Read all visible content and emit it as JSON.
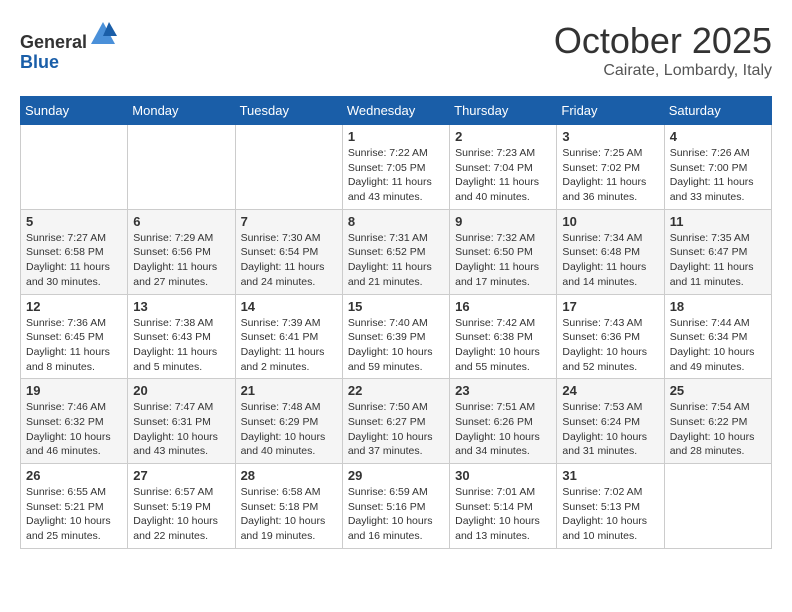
{
  "header": {
    "logo_general": "General",
    "logo_blue": "Blue",
    "month_title": "October 2025",
    "location": "Cairate, Lombardy, Italy"
  },
  "calendar": {
    "days_of_week": [
      "Sunday",
      "Monday",
      "Tuesday",
      "Wednesday",
      "Thursday",
      "Friday",
      "Saturday"
    ],
    "weeks": [
      [
        {
          "day": "",
          "info": ""
        },
        {
          "day": "",
          "info": ""
        },
        {
          "day": "",
          "info": ""
        },
        {
          "day": "1",
          "info": "Sunrise: 7:22 AM\nSunset: 7:05 PM\nDaylight: 11 hours\nand 43 minutes."
        },
        {
          "day": "2",
          "info": "Sunrise: 7:23 AM\nSunset: 7:04 PM\nDaylight: 11 hours\nand 40 minutes."
        },
        {
          "day": "3",
          "info": "Sunrise: 7:25 AM\nSunset: 7:02 PM\nDaylight: 11 hours\nand 36 minutes."
        },
        {
          "day": "4",
          "info": "Sunrise: 7:26 AM\nSunset: 7:00 PM\nDaylight: 11 hours\nand 33 minutes."
        }
      ],
      [
        {
          "day": "5",
          "info": "Sunrise: 7:27 AM\nSunset: 6:58 PM\nDaylight: 11 hours\nand 30 minutes."
        },
        {
          "day": "6",
          "info": "Sunrise: 7:29 AM\nSunset: 6:56 PM\nDaylight: 11 hours\nand 27 minutes."
        },
        {
          "day": "7",
          "info": "Sunrise: 7:30 AM\nSunset: 6:54 PM\nDaylight: 11 hours\nand 24 minutes."
        },
        {
          "day": "8",
          "info": "Sunrise: 7:31 AM\nSunset: 6:52 PM\nDaylight: 11 hours\nand 21 minutes."
        },
        {
          "day": "9",
          "info": "Sunrise: 7:32 AM\nSunset: 6:50 PM\nDaylight: 11 hours\nand 17 minutes."
        },
        {
          "day": "10",
          "info": "Sunrise: 7:34 AM\nSunset: 6:48 PM\nDaylight: 11 hours\nand 14 minutes."
        },
        {
          "day": "11",
          "info": "Sunrise: 7:35 AM\nSunset: 6:47 PM\nDaylight: 11 hours\nand 11 minutes."
        }
      ],
      [
        {
          "day": "12",
          "info": "Sunrise: 7:36 AM\nSunset: 6:45 PM\nDaylight: 11 hours\nand 8 minutes."
        },
        {
          "day": "13",
          "info": "Sunrise: 7:38 AM\nSunset: 6:43 PM\nDaylight: 11 hours\nand 5 minutes."
        },
        {
          "day": "14",
          "info": "Sunrise: 7:39 AM\nSunset: 6:41 PM\nDaylight: 11 hours\nand 2 minutes."
        },
        {
          "day": "15",
          "info": "Sunrise: 7:40 AM\nSunset: 6:39 PM\nDaylight: 10 hours\nand 59 minutes."
        },
        {
          "day": "16",
          "info": "Sunrise: 7:42 AM\nSunset: 6:38 PM\nDaylight: 10 hours\nand 55 minutes."
        },
        {
          "day": "17",
          "info": "Sunrise: 7:43 AM\nSunset: 6:36 PM\nDaylight: 10 hours\nand 52 minutes."
        },
        {
          "day": "18",
          "info": "Sunrise: 7:44 AM\nSunset: 6:34 PM\nDaylight: 10 hours\nand 49 minutes."
        }
      ],
      [
        {
          "day": "19",
          "info": "Sunrise: 7:46 AM\nSunset: 6:32 PM\nDaylight: 10 hours\nand 46 minutes."
        },
        {
          "day": "20",
          "info": "Sunrise: 7:47 AM\nSunset: 6:31 PM\nDaylight: 10 hours\nand 43 minutes."
        },
        {
          "day": "21",
          "info": "Sunrise: 7:48 AM\nSunset: 6:29 PM\nDaylight: 10 hours\nand 40 minutes."
        },
        {
          "day": "22",
          "info": "Sunrise: 7:50 AM\nSunset: 6:27 PM\nDaylight: 10 hours\nand 37 minutes."
        },
        {
          "day": "23",
          "info": "Sunrise: 7:51 AM\nSunset: 6:26 PM\nDaylight: 10 hours\nand 34 minutes."
        },
        {
          "day": "24",
          "info": "Sunrise: 7:53 AM\nSunset: 6:24 PM\nDaylight: 10 hours\nand 31 minutes."
        },
        {
          "day": "25",
          "info": "Sunrise: 7:54 AM\nSunset: 6:22 PM\nDaylight: 10 hours\nand 28 minutes."
        }
      ],
      [
        {
          "day": "26",
          "info": "Sunrise: 6:55 AM\nSunset: 5:21 PM\nDaylight: 10 hours\nand 25 minutes."
        },
        {
          "day": "27",
          "info": "Sunrise: 6:57 AM\nSunset: 5:19 PM\nDaylight: 10 hours\nand 22 minutes."
        },
        {
          "day": "28",
          "info": "Sunrise: 6:58 AM\nSunset: 5:18 PM\nDaylight: 10 hours\nand 19 minutes."
        },
        {
          "day": "29",
          "info": "Sunrise: 6:59 AM\nSunset: 5:16 PM\nDaylight: 10 hours\nand 16 minutes."
        },
        {
          "day": "30",
          "info": "Sunrise: 7:01 AM\nSunset: 5:14 PM\nDaylight: 10 hours\nand 13 minutes."
        },
        {
          "day": "31",
          "info": "Sunrise: 7:02 AM\nSunset: 5:13 PM\nDaylight: 10 hours\nand 10 minutes."
        },
        {
          "day": "",
          "info": ""
        }
      ]
    ]
  }
}
